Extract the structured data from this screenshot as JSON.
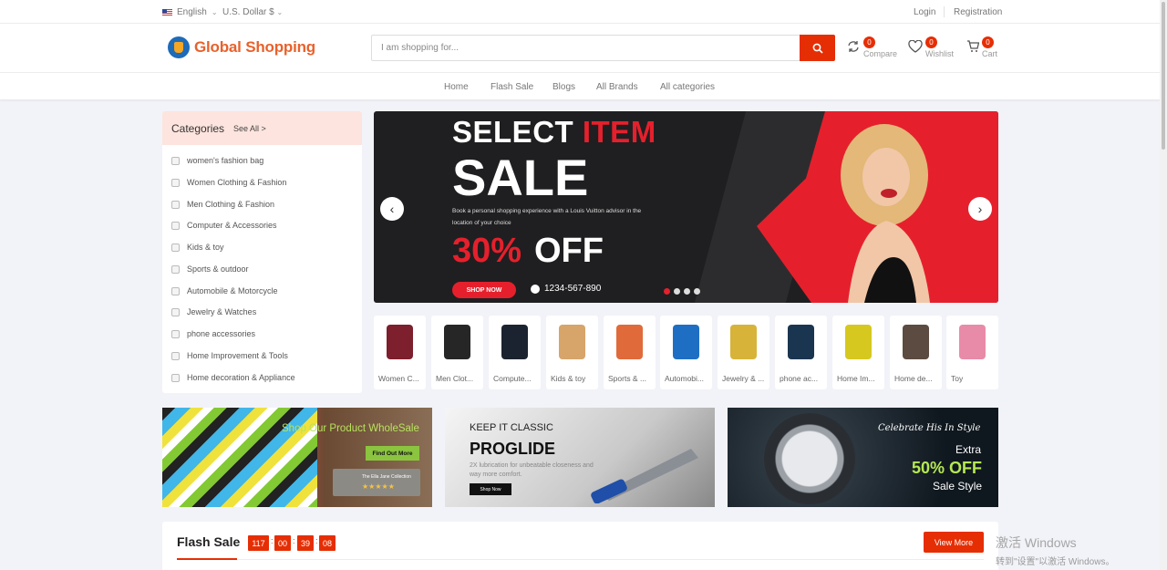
{
  "topbar": {
    "language": "English",
    "currency": "U.S. Dollar $",
    "login": "Login",
    "registration": "Registration"
  },
  "header": {
    "logo": "Global Shopping",
    "search_placeholder": "I am shopping for...",
    "compare": {
      "label": "Compare",
      "count": "0"
    },
    "wishlist": {
      "label": "Wishlist",
      "count": "0"
    },
    "cart": {
      "label": "Cart",
      "count": "0"
    }
  },
  "nav": [
    "Home",
    "Flash Sale",
    "Blogs",
    "All Brands",
    "All categories"
  ],
  "categories": {
    "title": "Categories",
    "see_all": "See All >",
    "items": [
      "women's fashion bag",
      "Women Clothing & Fashion",
      "Men Clothing & Fashion",
      "Computer & Accessories",
      "Kids & toy",
      "Sports & outdoor",
      "Automobile & Motorcycle",
      "Jewelry & Watches",
      "phone accessories",
      "Home Improvement & Tools",
      "Home decoration & Appliance"
    ]
  },
  "hero": {
    "line1a": "SELECT ",
    "line1b": "ITEM",
    "line2": "SALE",
    "description": "Book a personal shopping experience with a Louis Vuitton advisor in the location of your choice",
    "percent": "30%",
    "off": "OFF",
    "shop_now": "SHOP NOW",
    "phone": "1234-567-890",
    "prev_arrow": "‹",
    "next_arrow": "›",
    "active_dot": 0,
    "dot_count": 4
  },
  "thumbs": [
    {
      "label": "Women C...",
      "color": "#7d1f2c"
    },
    {
      "label": "Men Clot...",
      "color": "#262626"
    },
    {
      "label": "Compute...",
      "color": "#1c2330"
    },
    {
      "label": "Kids & toy",
      "color": "#d7a46a"
    },
    {
      "label": "Sports & ...",
      "color": "#e06a3a"
    },
    {
      "label": "Automobi...",
      "color": "#1e6fc4"
    },
    {
      "label": "Jewelry & ...",
      "color": "#d8b33a"
    },
    {
      "label": "phone ac...",
      "color": "#1a3550"
    },
    {
      "label": "Home Im...",
      "color": "#d7c820"
    },
    {
      "label": "Home de...",
      "color": "#5c4b40"
    },
    {
      "label": "Toy",
      "color": "#e88ba8"
    }
  ],
  "banners": {
    "b1": {
      "text": "Shop Our Product WholeSale",
      "button": "Find Out More",
      "card_name": "The Ella Jane Collection",
      "stars": "★★★★★"
    },
    "b2": {
      "kicker": "KEEP IT CLASSIC",
      "title": "PROGLIDE",
      "desc": "2X lubrication for unbeatable closeness and way more comfort.",
      "button": "Shop Now"
    },
    "b3": {
      "celebrate": "Celebrate His In Style",
      "extra": "Extra",
      "off": "50% OFF",
      "sale": "Sale Style"
    }
  },
  "flash": {
    "title": "Flash Sale",
    "timer": [
      "117",
      "00",
      "39",
      "08"
    ],
    "view_more": "View More"
  },
  "watermark": {
    "line1": "激活 Windows",
    "line2": "转到\"设置\"以激活 Windows。"
  },
  "colors": {
    "accent": "#e62e04",
    "hero_red": "#e5202c"
  }
}
